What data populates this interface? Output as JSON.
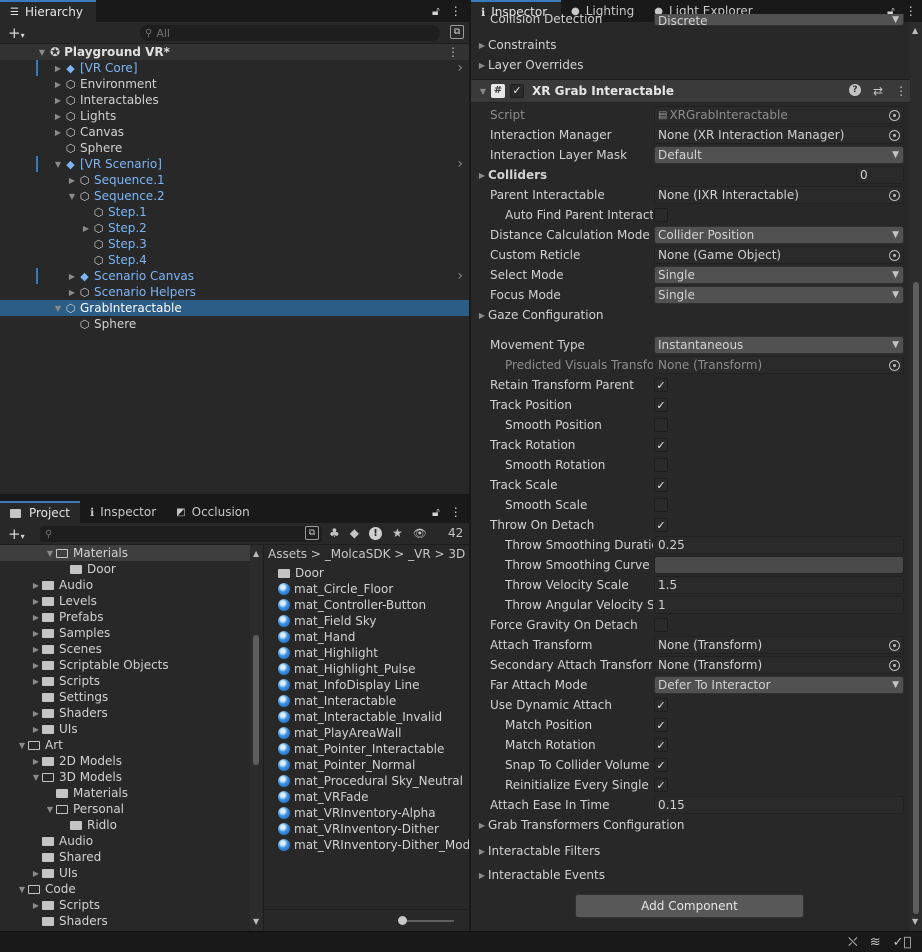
{
  "hierarchy": {
    "tab_label": "Hierarchy",
    "search_placeholder": "All",
    "scene_name": "Playground VR*",
    "items": [
      {
        "label": "[VR Core]",
        "blue": true,
        "arrow": "right",
        "icon": "prefab-cube",
        "chevron": true
      },
      {
        "label": "Environment",
        "arrow": "right",
        "icon": "cube"
      },
      {
        "label": "Interactables",
        "arrow": "right",
        "icon": "cube"
      },
      {
        "label": "Lights",
        "arrow": "right",
        "icon": "cube"
      },
      {
        "label": "Canvas",
        "arrow": "right",
        "icon": "cube"
      },
      {
        "label": "Sphere",
        "arrow": "",
        "icon": "cube"
      },
      {
        "label": "[VR Scenario]",
        "blue": true,
        "arrow": "down",
        "icon": "prefab-cube",
        "chevron": true
      },
      {
        "label": "Sequence.1",
        "blue": true,
        "arrow": "right",
        "icon": "cube"
      },
      {
        "label": "Sequence.2",
        "blue": true,
        "arrow": "down",
        "icon": "cube"
      },
      {
        "label": "Step.1",
        "blue": true,
        "arrow": "",
        "icon": "cube"
      },
      {
        "label": "Step.2",
        "blue": true,
        "arrow": "right",
        "icon": "cube"
      },
      {
        "label": "Step.3",
        "blue": true,
        "arrow": "",
        "icon": "cube"
      },
      {
        "label": "Step.4",
        "blue": true,
        "arrow": "",
        "icon": "cube"
      },
      {
        "label": "Scenario Canvas",
        "blue": true,
        "arrow": "right",
        "icon": "prefab-cube",
        "chevron": true
      },
      {
        "label": "Scenario Helpers",
        "blue": true,
        "arrow": "right",
        "icon": "cube"
      },
      {
        "label": "GrabInteractable",
        "arrow": "down",
        "icon": "cube",
        "selected": true
      },
      {
        "label": "Sphere",
        "arrow": "",
        "icon": "cube"
      }
    ]
  },
  "project": {
    "tabs": [
      "Project",
      "Inspector",
      "Occlusion"
    ],
    "badge_count": "42",
    "tree": [
      {
        "label": "Materials",
        "arrow": "down",
        "folder": "open",
        "selected": true
      },
      {
        "label": "Door",
        "arrow": "",
        "folder": "closed"
      },
      {
        "label": "Audio",
        "arrow": "right",
        "folder": "closed"
      },
      {
        "label": "Levels",
        "arrow": "right",
        "folder": "closed"
      },
      {
        "label": "Prefabs",
        "arrow": "right",
        "folder": "closed"
      },
      {
        "label": "Samples",
        "arrow": "right",
        "folder": "closed"
      },
      {
        "label": "Scenes",
        "arrow": "right",
        "folder": "closed"
      },
      {
        "label": "Scriptable Objects",
        "arrow": "right",
        "folder": "closed"
      },
      {
        "label": "Scripts",
        "arrow": "right",
        "folder": "closed"
      },
      {
        "label": "Settings",
        "arrow": "",
        "folder": "closed"
      },
      {
        "label": "Shaders",
        "arrow": "right",
        "folder": "closed"
      },
      {
        "label": "UIs",
        "arrow": "right",
        "folder": "closed"
      },
      {
        "label": "Art",
        "arrow": "down",
        "folder": "open"
      },
      {
        "label": "2D Models",
        "arrow": "right",
        "folder": "closed"
      },
      {
        "label": "3D Models",
        "arrow": "down",
        "folder": "open"
      },
      {
        "label": "Materials",
        "arrow": "",
        "folder": "closed"
      },
      {
        "label": "Personal",
        "arrow": "down",
        "folder": "open"
      },
      {
        "label": "Ridlo",
        "arrow": "",
        "folder": "closed"
      },
      {
        "label": "Audio",
        "arrow": "",
        "folder": "closed"
      },
      {
        "label": "Shared",
        "arrow": "",
        "folder": "closed"
      },
      {
        "label": "UIs",
        "arrow": "right",
        "folder": "closed"
      },
      {
        "label": "Code",
        "arrow": "down",
        "folder": "open"
      },
      {
        "label": "Scripts",
        "arrow": "right",
        "folder": "closed"
      },
      {
        "label": "Shaders",
        "arrow": "",
        "folder": "closed"
      }
    ],
    "breadcrumb": "Assets > _MolcaSDK > _VR > 3D >",
    "assets": [
      "Door",
      "mat_Circle_Floor",
      "mat_Controller-Button",
      "mat_Field Sky",
      "mat_Hand",
      "mat_Highlight",
      "mat_Highlight_Pulse",
      "mat_InfoDisplay Line",
      "mat_Interactable",
      "mat_Interactable_Invalid",
      "mat_PlayAreaWall",
      "mat_Pointer_Interactable",
      "mat_Pointer_Normal",
      "mat_Procedural Sky_Neutral",
      "mat_VRFade",
      "mat_VRInventory-Alpha",
      "mat_VRInventory-Dither",
      "mat_VRInventory-Dither_Mode"
    ]
  },
  "inspector": {
    "tabs": [
      "Inspector",
      "Lighting",
      "Light Explorer"
    ],
    "cut_label": "Collision Detection",
    "cut_value": "Discrete",
    "constraints": "Constraints",
    "layer_overrides": "Layer Overrides",
    "component_title": "XR Grab Interactable",
    "add_component": "Add Component",
    "props": [
      {
        "label": "Script",
        "value": "XRGrabInteractable",
        "kind": "obj",
        "dim": true
      },
      {
        "label": "Interaction Manager",
        "value": "None (XR Interaction Manager)",
        "kind": "obj"
      },
      {
        "label": "Interaction Layer Mask",
        "value": "Default",
        "kind": "dd"
      },
      {
        "label": "Colliders",
        "value": "0",
        "kind": "foldnum",
        "bold": true
      },
      {
        "label": "Parent Interactable",
        "value": "None (IXR Interactable)",
        "kind": "obj"
      },
      {
        "label": "Auto Find Parent Interacta",
        "value": "",
        "kind": "chk",
        "checked": false,
        "indent": true
      },
      {
        "label": "Distance Calculation Mode",
        "value": "Collider Position",
        "kind": "dd"
      },
      {
        "label": "Custom Reticle",
        "value": "None (Game Object)",
        "kind": "obj"
      },
      {
        "label": "Select Mode",
        "value": "Single",
        "kind": "dd"
      },
      {
        "label": "Focus Mode",
        "value": "Single",
        "kind": "dd"
      },
      {
        "label": "Gaze Configuration",
        "value": "",
        "kind": "fold"
      },
      {
        "label": "Movement Type",
        "value": "Instantaneous",
        "kind": "dd",
        "gap": true
      },
      {
        "label": "Predicted Visuals Transfor",
        "value": "None (Transform)",
        "kind": "obj",
        "indent": true,
        "dim": true
      },
      {
        "label": "Retain Transform Parent",
        "value": "",
        "kind": "chk",
        "checked": true
      },
      {
        "label": "Track Position",
        "value": "",
        "kind": "chk",
        "checked": true
      },
      {
        "label": "Smooth Position",
        "value": "",
        "kind": "chk",
        "checked": false,
        "indent": true
      },
      {
        "label": "Track Rotation",
        "value": "",
        "kind": "chk",
        "checked": true
      },
      {
        "label": "Smooth Rotation",
        "value": "",
        "kind": "chk",
        "checked": false,
        "indent": true
      },
      {
        "label": "Track Scale",
        "value": "",
        "kind": "chk",
        "checked": true
      },
      {
        "label": "Smooth Scale",
        "value": "",
        "kind": "chk",
        "checked": false,
        "indent": true
      },
      {
        "label": "Throw On Detach",
        "value": "",
        "kind": "chk",
        "checked": true
      },
      {
        "label": "Throw Smoothing Duration",
        "value": "0.25",
        "kind": "txt",
        "indent": true
      },
      {
        "label": "Throw Smoothing Curve",
        "value": "",
        "kind": "curve",
        "indent": true
      },
      {
        "label": "Throw Velocity Scale",
        "value": "1.5",
        "kind": "txt",
        "indent": true
      },
      {
        "label": "Throw Angular Velocity Sc",
        "value": "1",
        "kind": "txt",
        "indent": true
      },
      {
        "label": "Force Gravity On Detach",
        "value": "",
        "kind": "chk",
        "checked": false
      },
      {
        "label": "Attach Transform",
        "value": "None (Transform)",
        "kind": "obj"
      },
      {
        "label": "Secondary Attach Transform",
        "value": "None (Transform)",
        "kind": "obj"
      },
      {
        "label": "Far Attach Mode",
        "value": "Defer To Interactor",
        "kind": "dd"
      },
      {
        "label": "Use Dynamic Attach",
        "value": "",
        "kind": "chk",
        "checked": true
      },
      {
        "label": "Match Position",
        "value": "",
        "kind": "chk",
        "checked": true,
        "indent": true
      },
      {
        "label": "Match Rotation",
        "value": "",
        "kind": "chk",
        "checked": true,
        "indent": true
      },
      {
        "label": "Snap To Collider Volume",
        "value": "",
        "kind": "chk",
        "checked": true,
        "indent": true
      },
      {
        "label": "Reinitialize Every Single Gr",
        "value": "",
        "kind": "chk",
        "checked": true,
        "indent": true
      },
      {
        "label": "Attach Ease In Time",
        "value": "0.15",
        "kind": "txt"
      },
      {
        "label": "Grab Transformers Configuration",
        "value": "",
        "kind": "fold"
      },
      {
        "label": "Interactable Filters",
        "value": "",
        "kind": "fold",
        "gap": true
      },
      {
        "label": "Interactable Events",
        "value": "",
        "kind": "fold",
        "gap": true
      }
    ]
  },
  "colors": {
    "selection": "#2c5d87",
    "accent": "#3a79bb",
    "prefab_blue": "#7bb4f4"
  }
}
